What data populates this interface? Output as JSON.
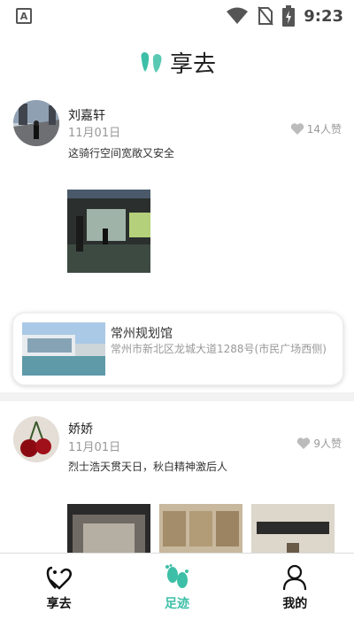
{
  "status_bar": {
    "time": "9:23",
    "notif_icon": "A"
  },
  "header": {
    "title": "享去",
    "logo_icon": "footprints-logo-icon"
  },
  "posts": [
    {
      "user": "刘嘉轩",
      "date": "11月01日",
      "likes": "14人赞",
      "text": "这骑行空间宽敞又安全",
      "location": {
        "name": "常州规划馆",
        "address": "常州市新北区龙城大道1288号(市民广场西侧)"
      }
    },
    {
      "user": "娇娇",
      "date": "11月01日",
      "likes": "9人赞",
      "text": "烈士浩天贯天日，秋白精神激后人"
    }
  ],
  "tabs": [
    {
      "label": "享去",
      "icon": "share-heart-icon"
    },
    {
      "label": "足迹",
      "icon": "footprints-icon"
    },
    {
      "label": "我的",
      "icon": "user-icon"
    }
  ],
  "colors": {
    "accent": "#3cbfa6",
    "like": "#bbbbbb"
  }
}
